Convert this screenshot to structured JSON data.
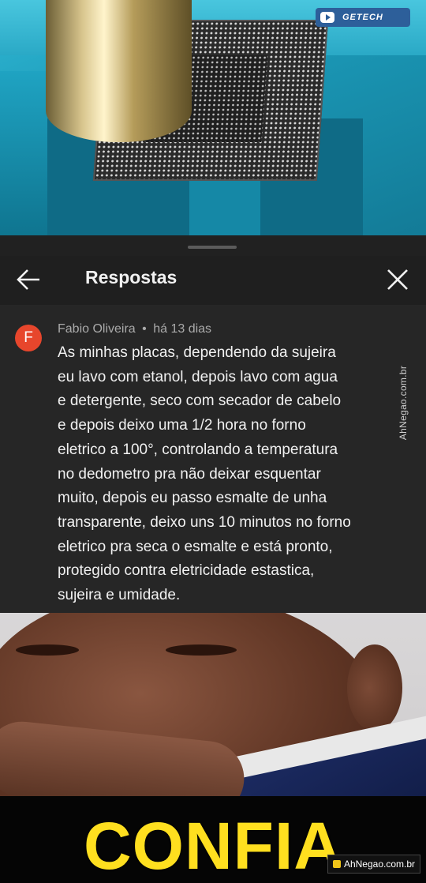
{
  "video": {
    "channel_badge": "GETECH"
  },
  "panel": {
    "title": "Respostas",
    "back_icon": "arrow-left-icon",
    "close_icon": "close-icon"
  },
  "comment": {
    "avatar_letter": "F",
    "author": "Fabio Oliveira",
    "separator": "•",
    "time": "há 13 dias",
    "lines": [
      "As minhas placas, dependendo da sujeira",
      "eu lavo com etanol, depois lavo com agua",
      "e detergente, seco com secador de cabelo",
      "e depois deixo uma 1/2 hora no forno",
      "eletrico a 100°, controlando a temperatura",
      "no dedometro pra não deixar esquentar",
      "muito, depois eu passo esmalte de unha",
      "transparente, deixo uns 10 minutos no forno",
      "eletrico pra seca o esmalte e está pronto,",
      "protegido contra eletricidade estastica,",
      "sujeira e umidade."
    ]
  },
  "meme": {
    "caption": "CONFIA"
  },
  "watermarks": {
    "side": "AhNegao.com.br",
    "bottom": "AhNegao.com.br"
  },
  "colors": {
    "panel_bg": "#212121",
    "avatar_bg": "#e7462c",
    "caption": "#ffdf1f"
  }
}
